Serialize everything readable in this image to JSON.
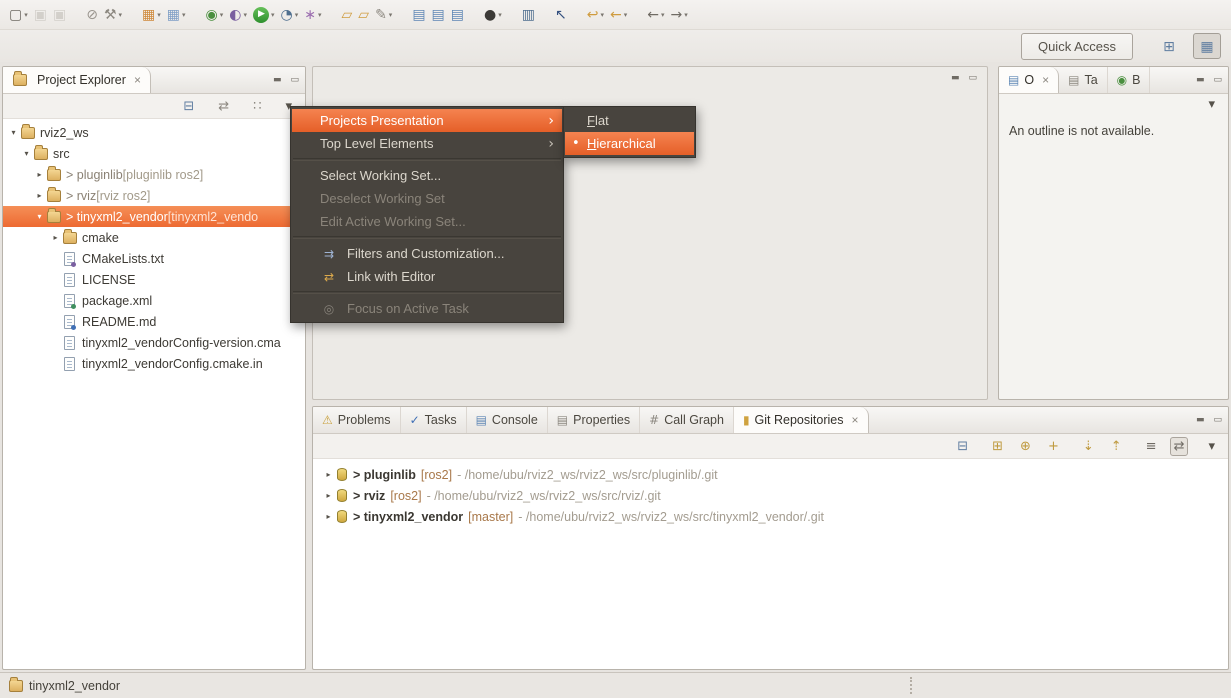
{
  "icons": {
    "caret": "▾",
    "close": "×",
    "minimize": "▬",
    "maximize": "▭",
    "submenu_arrow": "›",
    "radio_dot": "•",
    "tree_collapsed": "▸",
    "tree_expanded": "▾"
  },
  "colors": {
    "selection_orange": "#ed6a32",
    "menu_background": "#48443e",
    "menu_text": "#dcd7cd",
    "window_background": "#e7e4e0",
    "branch_decoration": "#a8784a"
  },
  "toolbar": {
    "quick_access": "Quick Access",
    "open_perspective_glyph": "⊞",
    "cpp_perspective_glyph": "▦",
    "buttons": [
      {
        "name": "new-wizard-button",
        "glyph": "▢",
        "color": "#6f6b64",
        "dropdown": true
      },
      {
        "name": "save-button",
        "glyph": "▣",
        "color": "#b8b4ad",
        "disabled": true
      },
      {
        "name": "save-all-button",
        "glyph": "▣",
        "color": "#b8b4ad",
        "disabled": true
      },
      {
        "name": "skip-all-breakpoints-button",
        "glyph": "⊘",
        "color": "#9a958e",
        "gap": true
      },
      {
        "name": "build-all-button",
        "glyph": "⚒",
        "color": "#8c8880",
        "dropdown": true
      },
      {
        "name": "new-c-project-button",
        "glyph": "▦",
        "color": "#cf8a3c",
        "dropdown": true,
        "gap": true
      },
      {
        "name": "new-cpp-class-button",
        "glyph": "▦",
        "color": "#7f9fc6",
        "dropdown": true
      },
      {
        "name": "debug-button",
        "glyph": "◉",
        "color": "#4a8f3f",
        "dropdown": true,
        "gap": true
      },
      {
        "name": "coverage-button",
        "glyph": "◐",
        "color": "#7a5fa0",
        "dropdown": true
      },
      {
        "name": "run-button",
        "glyph": "▶",
        "color": "#ffffff",
        "dropdown": true,
        "run": true
      },
      {
        "name": "profile-button",
        "glyph": "◔",
        "color": "#4f6f8f",
        "dropdown": true
      },
      {
        "name": "external-tools-button",
        "glyph": "∗",
        "color": "#9c6fb0",
        "dropdown": true
      },
      {
        "name": "open-task-folder-button",
        "glyph": "▱",
        "color": "#cf9c3f",
        "gap": true
      },
      {
        "name": "open-resource-folder-button",
        "glyph": "▱",
        "color": "#cf9c3f"
      },
      {
        "name": "search-wand-button",
        "glyph": "✎",
        "color": "#8c8880",
        "dropdown": true
      },
      {
        "name": "console-view-button",
        "glyph": "▤",
        "color": "#5f87b5",
        "gap": true
      },
      {
        "name": "display-console-button",
        "glyph": "▤",
        "color": "#5f87b5"
      },
      {
        "name": "pin-console-button",
        "glyph": "▤",
        "color": "#5f87b5"
      },
      {
        "name": "user-profile-button",
        "glyph": "●",
        "color": "#3c3a37",
        "dropdown": true,
        "gap": true
      },
      {
        "name": "terminal-button",
        "glyph": "▥",
        "color": "#4f6f8f",
        "gap": true
      },
      {
        "name": "pointer-mode-button",
        "glyph": "↖",
        "color": "#33507f",
        "gap": true
      },
      {
        "name": "last-edit-location-button",
        "glyph": "↩",
        "color": "#cf9c3f",
        "dropdown": true,
        "gap": true
      },
      {
        "name": "previous-edit-button",
        "glyph": "←",
        "color": "#cf9c3f",
        "dropdown": true
      },
      {
        "name": "back-button",
        "glyph": "←",
        "color": "#6f6b64",
        "dropdown": true,
        "gap": true
      },
      {
        "name": "forward-button",
        "glyph": "→",
        "color": "#6f6b64",
        "dropdown": true
      }
    ]
  },
  "project_explorer": {
    "title": "Project Explorer",
    "toolbar": [
      {
        "name": "collapse-all-icon",
        "glyph": "⊟",
        "color": "#5f7da0"
      },
      {
        "name": "link-with-editor-icon",
        "glyph": "⇄",
        "color": "#8c8880",
        "gap": true
      },
      {
        "name": "working-sets-icon",
        "glyph": "∷",
        "color": "#8c8880",
        "gap": true
      },
      {
        "name": "view-menu-icon",
        "glyph": "▾",
        "color": "#56524a",
        "gap": true
      }
    ],
    "tree": [
      {
        "name": "tree-item-rviz2-ws",
        "level": 0,
        "arrow": "▾",
        "icon": "icon-folder-open",
        "label": "rviz2_ws",
        "suffix": ""
      },
      {
        "name": "tree-item-src",
        "level": 1,
        "arrow": "▾",
        "icon": "icon-folder",
        "label": "src",
        "suffix": ""
      },
      {
        "name": "tree-item-pluginlib",
        "level": 2,
        "arrow": "▸",
        "icon": "icon-folder",
        "label": "> pluginlib",
        "suffix": " [pluginlib ros2]",
        "dim": true
      },
      {
        "name": "tree-item-rviz",
        "level": 2,
        "arrow": "▸",
        "icon": "icon-folder",
        "label": "> rviz",
        "suffix": " [rviz ros2]",
        "dim": true
      },
      {
        "name": "tree-item-tinyxml2-vendor",
        "level": 2,
        "arrow": "▾",
        "icon": "icon-folder",
        "label": "> tinyxml2_vendor",
        "suffix": " [tinyxml2_vendo",
        "selected": true
      },
      {
        "name": "tree-item-cmake",
        "level": 3,
        "arrow": "▸",
        "icon": "icon-folder",
        "label": "cmake",
        "suffix": ""
      },
      {
        "name": "tree-item-cmakelists",
        "level": 3,
        "arrow": "",
        "icon": "icon-file-cmake",
        "label": "CMakeLists.txt",
        "suffix": ""
      },
      {
        "name": "tree-item-license",
        "level": 3,
        "arrow": "",
        "icon": "icon-file",
        "label": "LICENSE",
        "suffix": ""
      },
      {
        "name": "tree-item-package-xml",
        "level": 3,
        "arrow": "",
        "icon": "icon-file-xml",
        "label": "package.xml",
        "suffix": ""
      },
      {
        "name": "tree-item-readme",
        "level": 3,
        "arrow": "",
        "icon": "icon-file-md",
        "label": "README.md",
        "suffix": ""
      },
      {
        "name": "tree-item-config-version",
        "level": 3,
        "arrow": "",
        "icon": "icon-file",
        "label": "tinyxml2_vendorConfig-version.cma",
        "suffix": ""
      },
      {
        "name": "tree-item-config-cmake-in",
        "level": 3,
        "arrow": "",
        "icon": "icon-file",
        "label": "tinyxml2_vendorConfig.cmake.in",
        "suffix": ""
      }
    ]
  },
  "outline": {
    "tabs": [
      {
        "name": "tab-outline",
        "label": "O",
        "glyph": "▤",
        "color": "#5f87b5",
        "active": true
      },
      {
        "name": "tab-task-list",
        "label": "Ta",
        "glyph": "▤",
        "color": "#8c8880"
      },
      {
        "name": "tab-build",
        "label": "B",
        "glyph": "◉",
        "color": "#4a8f3f"
      }
    ],
    "toolbar": [
      {
        "name": "view-menu-icon",
        "glyph": "▾",
        "color": "#56524a"
      }
    ],
    "message": "An outline is not available."
  },
  "bottom": {
    "tabs": [
      {
        "name": "tab-problems",
        "label": "Problems",
        "glyph": "⚠",
        "color": "#c9a23f"
      },
      {
        "name": "tab-tasks",
        "label": "Tasks",
        "glyph": "✓",
        "color": "#3f6fb5"
      },
      {
        "name": "tab-console",
        "label": "Console",
        "glyph": "▤",
        "color": "#5f87b5"
      },
      {
        "name": "tab-properties",
        "label": "Properties",
        "glyph": "▤",
        "color": "#8c8880"
      },
      {
        "name": "tab-call-graph",
        "label": "Call Graph",
        "glyph": "#",
        "color": "#8c8880"
      },
      {
        "name": "tab-git-repositories",
        "label": "Git Repositories",
        "glyph": "▮",
        "color": "#cfa23f",
        "active": true
      }
    ],
    "toolbar": [
      {
        "name": "collapse-all-icon",
        "glyph": "⊟",
        "color": "#5f7da0"
      },
      {
        "name": "add-repository-icon",
        "glyph": "⊞",
        "color": "#bf9a3f",
        "gap": true
      },
      {
        "name": "clone-repository-icon",
        "glyph": "⊕",
        "color": "#bf9a3f"
      },
      {
        "name": "create-repository-icon",
        "glyph": "+",
        "color": "#bf9a3f"
      },
      {
        "name": "fetch-icon",
        "glyph": "⇣",
        "color": "#bf9a3f",
        "gap": true
      },
      {
        "name": "push-icon",
        "glyph": "⇡",
        "color": "#bf9a3f"
      },
      {
        "name": "hierarchy-layout-icon",
        "glyph": "≡",
        "color": "#6f6b64",
        "gap": true
      },
      {
        "name": "link-with-selection-icon",
        "glyph": "⇄",
        "color": "#6f6b64",
        "active": true
      },
      {
        "name": "view-menu-icon",
        "glyph": "▾",
        "color": "#56524a",
        "gap": true
      }
    ],
    "repositories": [
      {
        "name": "repo-pluginlib",
        "label": "> pluginlib",
        "branch": "[ros2]",
        "path": "- /home/ubu/rviz2_ws/rviz2_ws/src/pluginlib/.git"
      },
      {
        "name": "repo-rviz",
        "label": "> rviz",
        "branch": "[ros2]",
        "path": "- /home/ubu/rviz2_ws/rviz2_ws/src/rviz/.git"
      },
      {
        "name": "repo-tinyxml2-vendor",
        "label": "> tinyxml2_vendor",
        "branch": "[master]",
        "path": "- /home/ubu/rviz2_ws/rviz2_ws/src/tinyxml2_vendor/.git"
      }
    ]
  },
  "context_menu": {
    "items": [
      {
        "name": "menu-item-projects-presentation",
        "label_pre": "Projects Presentation",
        "highlighted": true,
        "has_submenu": true
      },
      {
        "name": "menu-item-top-level-elements",
        "label_pre": "Top Level Elements",
        "has_submenu": true
      },
      {
        "separator": true
      },
      {
        "name": "menu-item-select-working-set",
        "label_pre": "Select Working Set..."
      },
      {
        "name": "menu-item-deselect-working-set",
        "label_pre": "Deselect Working Set",
        "disabled": true
      },
      {
        "name": "menu-item-edit-active-working-set",
        "label_pre": "Edit Active Working Set...",
        "disabled": true
      },
      {
        "separator": true
      },
      {
        "name": "menu-item-filters-customization",
        "label_pre": "Filters and Customization...",
        "has_icon": true,
        "icon_glyph": "⇉",
        "icon_color": "#9fb4d4"
      },
      {
        "name": "menu-item-link-with-editor",
        "label_pre": "Link with Editor",
        "has_icon": true,
        "icon_glyph": "⇄",
        "icon_color": "#dba94c"
      },
      {
        "separator": true
      },
      {
        "name": "menu-item-focus-on-active-task",
        "label_pre": "Focus on Active Task",
        "disabled": true,
        "has_icon": true,
        "icon_glyph": "◎",
        "icon_color": "#87827a"
      }
    ]
  },
  "submenu": {
    "items": [
      {
        "name": "menu-item-flat",
        "label_pre": "",
        "label_accel": "F",
        "label_post": "lat"
      },
      {
        "name": "menu-item-hierarchical",
        "label_pre": "",
        "label_accel": "H",
        "label_post": "ierarchical",
        "selected": true,
        "highlighted": true
      }
    ]
  },
  "status_bar": {
    "text": "tinyxml2_vendor"
  }
}
